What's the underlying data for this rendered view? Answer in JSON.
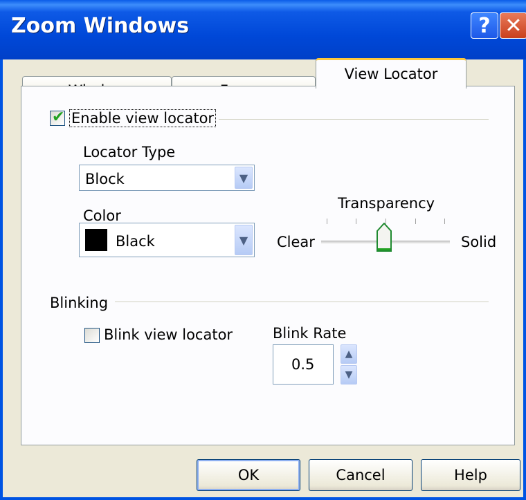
{
  "window": {
    "title": "Zoom Windows",
    "help_glyph": "?",
    "close_glyph": "✕"
  },
  "tabs": [
    {
      "label": "Window",
      "active": false
    },
    {
      "label": "Freeze",
      "active": false
    },
    {
      "label": "View Locator",
      "active": true
    }
  ],
  "view_locator": {
    "enable_label": "Enable view locator",
    "enable_checked": true,
    "locator_type_label": "Locator Type",
    "locator_type_value": "Block",
    "color_label": "Color",
    "color_value": "Black",
    "color_swatch": "#000000",
    "transparency_label": "Transparency",
    "transparency_min_label": "Clear",
    "transparency_max_label": "Solid",
    "transparency_level": 0.5
  },
  "blinking": {
    "section_label": "Blinking",
    "blink_label": "Blink view locator",
    "blink_checked": false,
    "rate_label": "Blink Rate",
    "rate_value": "0.5"
  },
  "buttons": {
    "ok": "OK",
    "cancel": "Cancel",
    "help": "Help"
  },
  "colors": {
    "titlebar": "#0054e3",
    "tab_highlight": "#ffc83c",
    "check_mark": "#21a121"
  },
  "icons": {
    "help": "help-icon",
    "close": "close-icon",
    "check": "check-icon",
    "dropdown": "chevron-down-icon",
    "spin_up": "chevron-up-icon",
    "spin_down": "chevron-down-icon"
  }
}
